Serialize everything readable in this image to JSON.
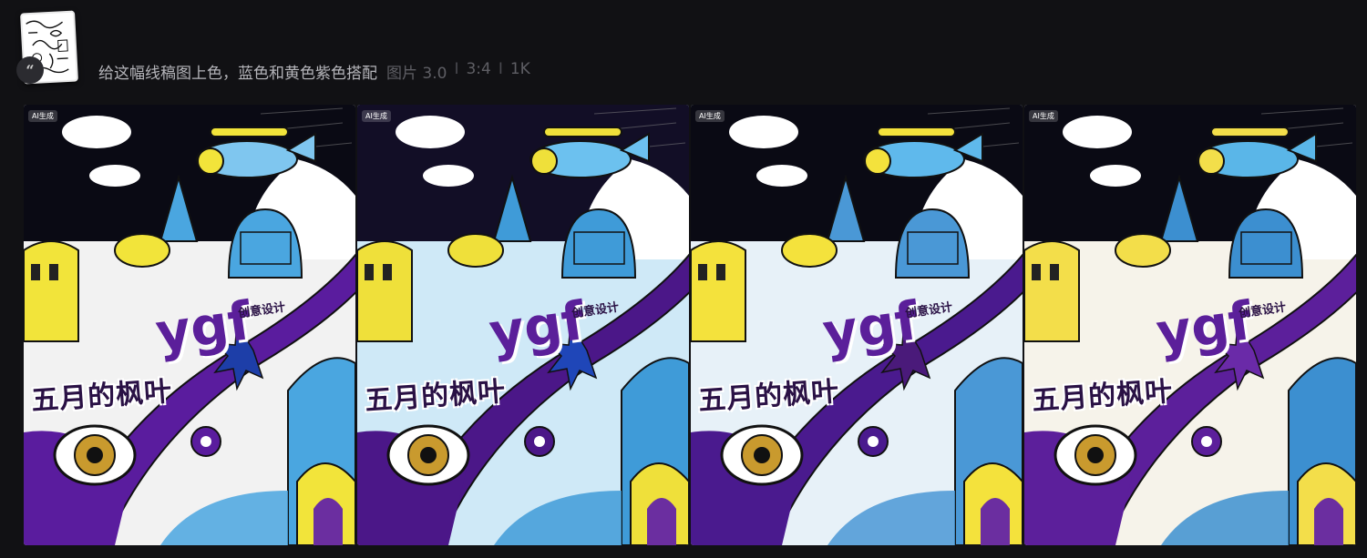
{
  "prompt": {
    "text": "给这幅线稿图上色，蓝色和黄色紫色搭配",
    "type_label": "图片 3.0",
    "separator": "I",
    "ratio": "3:4",
    "resolution": "1K"
  },
  "images": [
    {
      "badge": "AI生成",
      "title": "五月的枫叶",
      "brand": "ygf",
      "subtitle": "创意设计",
      "palette": {
        "sky": "#0a0a14",
        "ground": "#f2f2f2",
        "river": "#5a1c9e",
        "tower": "#f2e43a",
        "dome": "#4aa6e0",
        "leaf": "#1d3ea8",
        "plane": "#7fc6ef"
      }
    },
    {
      "badge": "AI生成",
      "title": "五月的枫叶",
      "brand": "ygf",
      "subtitle": "创意设计",
      "palette": {
        "sky": "#120e26",
        "ground": "#cfe9f7",
        "river": "#4b1788",
        "tower": "#efe03a",
        "dome": "#3f9bd8",
        "leaf": "#1f46b8",
        "plane": "#6cc1ef"
      }
    },
    {
      "badge": "AI生成",
      "title": "五月的枫叶",
      "brand": "ygf",
      "subtitle": "创意设计",
      "palette": {
        "sky": "#0a0a14",
        "ground": "#e7f1f8",
        "river": "#4a1a8e",
        "tower": "#f4e23c",
        "dome": "#4a98d6",
        "leaf": "#4a1a7a",
        "plane": "#5fb9ec"
      }
    },
    {
      "badge": "AI生成",
      "title": "五月的枫叶",
      "brand": "ygf",
      "subtitle": "创意设计",
      "palette": {
        "sky": "#0a0a14",
        "ground": "#f6f3ea",
        "river": "#5c1f9b",
        "tower": "#f3de4a",
        "dome": "#3c8fd0",
        "leaf": "#6a2aa8",
        "plane": "#5ab6e8"
      }
    }
  ],
  "icons": {
    "quote": "quote-icon",
    "reference": "reference-image-thumbnail"
  }
}
